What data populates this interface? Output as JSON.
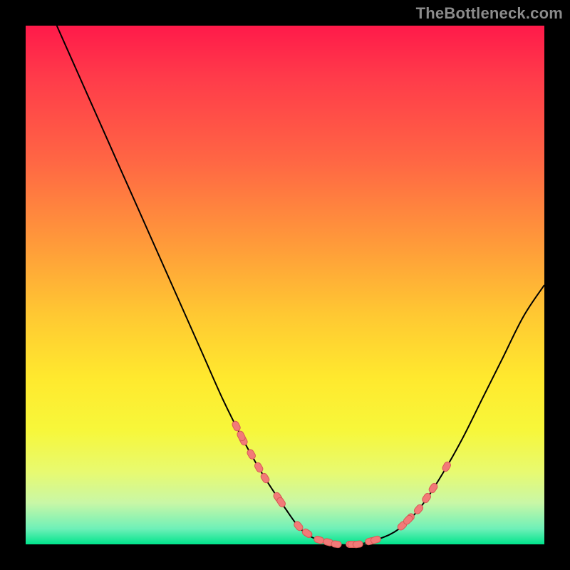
{
  "signature": "TheBottleneck.com",
  "colors": {
    "bg": "#000000",
    "curve": "#000000",
    "dot_fill": "#f27a78",
    "dot_stroke": "#d85a56"
  },
  "chart_data": {
    "type": "line",
    "title": "",
    "xlabel": "",
    "ylabel": "",
    "xlim": [
      0,
      100
    ],
    "ylim": [
      0,
      100
    ],
    "series": [
      {
        "name": "curve",
        "x": [
          6,
          10,
          14,
          18,
          22,
          26,
          30,
          34,
          38,
          42,
          46,
          50,
          53,
          56,
          60,
          64,
          68,
          72,
          76,
          80,
          84,
          88,
          92,
          96,
          100
        ],
        "y": [
          100,
          91,
          82,
          73,
          64,
          55,
          46,
          37,
          28,
          20,
          13,
          7,
          3,
          1,
          0,
          0,
          1,
          3,
          7,
          13,
          20,
          28,
          36,
          44,
          50
        ]
      }
    ],
    "dot_clusters": {
      "left": {
        "x_range": [
          40,
          50
        ],
        "y_range": [
          5,
          25
        ],
        "count": 9
      },
      "floor": {
        "x_range": [
          52,
          68
        ],
        "y_range": [
          0,
          3
        ],
        "count": 11
      },
      "right": {
        "x_range": [
          72,
          80
        ],
        "y_range": [
          5,
          18
        ],
        "count": 7
      }
    }
  }
}
